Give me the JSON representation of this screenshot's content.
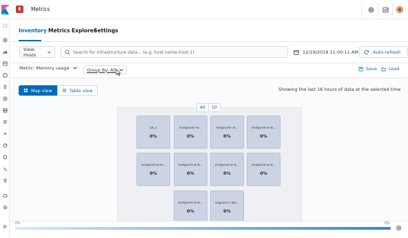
{
  "header": {
    "app_badge": "E",
    "title": "Metrics"
  },
  "tabs": [
    {
      "label": "Inventory",
      "active": true
    },
    {
      "label": "Metrics Explorer",
      "active": false
    },
    {
      "label": "Settings",
      "active": false
    }
  ],
  "toolbar": {
    "view_label": "View: Hosts",
    "search_placeholder": "Search for infrastructure data... (e.g. host.name:host-1)",
    "date": "12/19/2019 11:00:11 AM",
    "auto_refresh_label": "Auto-refresh"
  },
  "filters": {
    "metric_label": "Metric: Memory usage",
    "group_by_label": "Group By: All",
    "save_label": "Save",
    "load_label": "Load"
  },
  "view_toggle": {
    "map_label": "Map view",
    "table_label": "Table view",
    "selected": "map"
  },
  "showing_text": "Showing the last 16 hours of data at the selected time",
  "group": {
    "label": "All",
    "count": "10"
  },
  "nodes": [
    {
      "name": "DC1",
      "value": "0%"
    },
    {
      "name": "endpoint-l-8...",
      "value": "0%"
    },
    {
      "name": "endpoint--8...",
      "value": "0%"
    },
    {
      "name": "endpoint-w-8...",
      "value": "0%"
    },
    {
      "name": "endpoint-w-8...",
      "value": "0%"
    },
    {
      "name": "endpoint-w-8...",
      "value": "0%"
    },
    {
      "name": "endpoint-w-8...",
      "value": "0%"
    },
    {
      "name": "endpoint-w-8...",
      "value": "0%"
    },
    {
      "name": "endpoint-w-8...",
      "value": "0%"
    },
    {
      "name": "vagrant's Ma...",
      "value": "0%"
    }
  ],
  "timeline": {
    "min_label": "0%",
    "max_label": "0%",
    "fill": 1.0
  },
  "colors": {
    "accent": "#006bb8",
    "node_fill": "#ccd4e4",
    "badge": "#b9413a"
  }
}
